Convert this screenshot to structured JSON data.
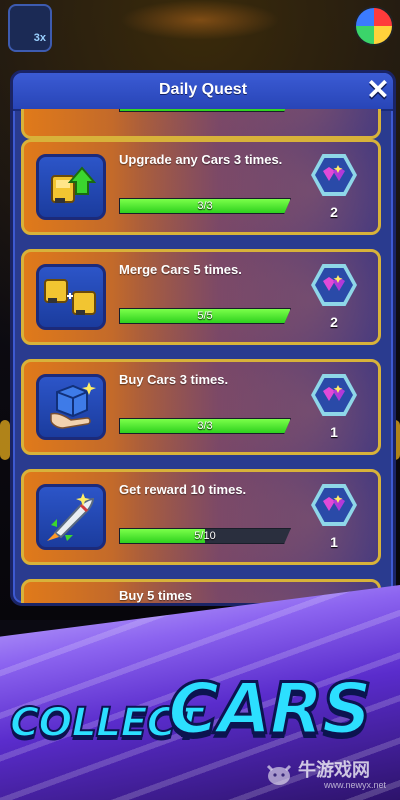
{
  "header": {
    "title": "Daily Quest",
    "close_label": "✕"
  },
  "quests": [
    {
      "icon": "truck-upgrade-icon",
      "text": "Upgrade any Cars 3 times.",
      "progress_label": "3/3",
      "progress": 1.0,
      "reward": "2"
    },
    {
      "icon": "merge-trucks-icon",
      "text": "Merge Cars 5 times.",
      "progress_label": "5/5",
      "progress": 1.0,
      "reward": "2"
    },
    {
      "icon": "buy-cube-icon",
      "text": "Buy Cars 3 times.",
      "progress_label": "3/3",
      "progress": 1.0,
      "reward": "1"
    },
    {
      "icon": "rocket-icon",
      "text": "Get reward 10 times.",
      "progress_label": "5/10",
      "progress": 0.5,
      "reward": "1"
    },
    {
      "icon": "partial-icon",
      "text": "Buy 5 times",
      "progress_label": "",
      "progress": 0,
      "reward": ""
    }
  ],
  "reward_icon": "gem-stars-icon",
  "background": {
    "badge_text": "3x"
  },
  "banner": {
    "word1": "COLLECT",
    "word2": "CARS"
  },
  "watermark": {
    "text": "牛游戏网",
    "url": "www.newyx.net"
  },
  "colors": {
    "accent": "#2cdfff",
    "card_border": "#d8b23a",
    "progress": "#2ed11e",
    "panel": "#2a3b8f"
  }
}
